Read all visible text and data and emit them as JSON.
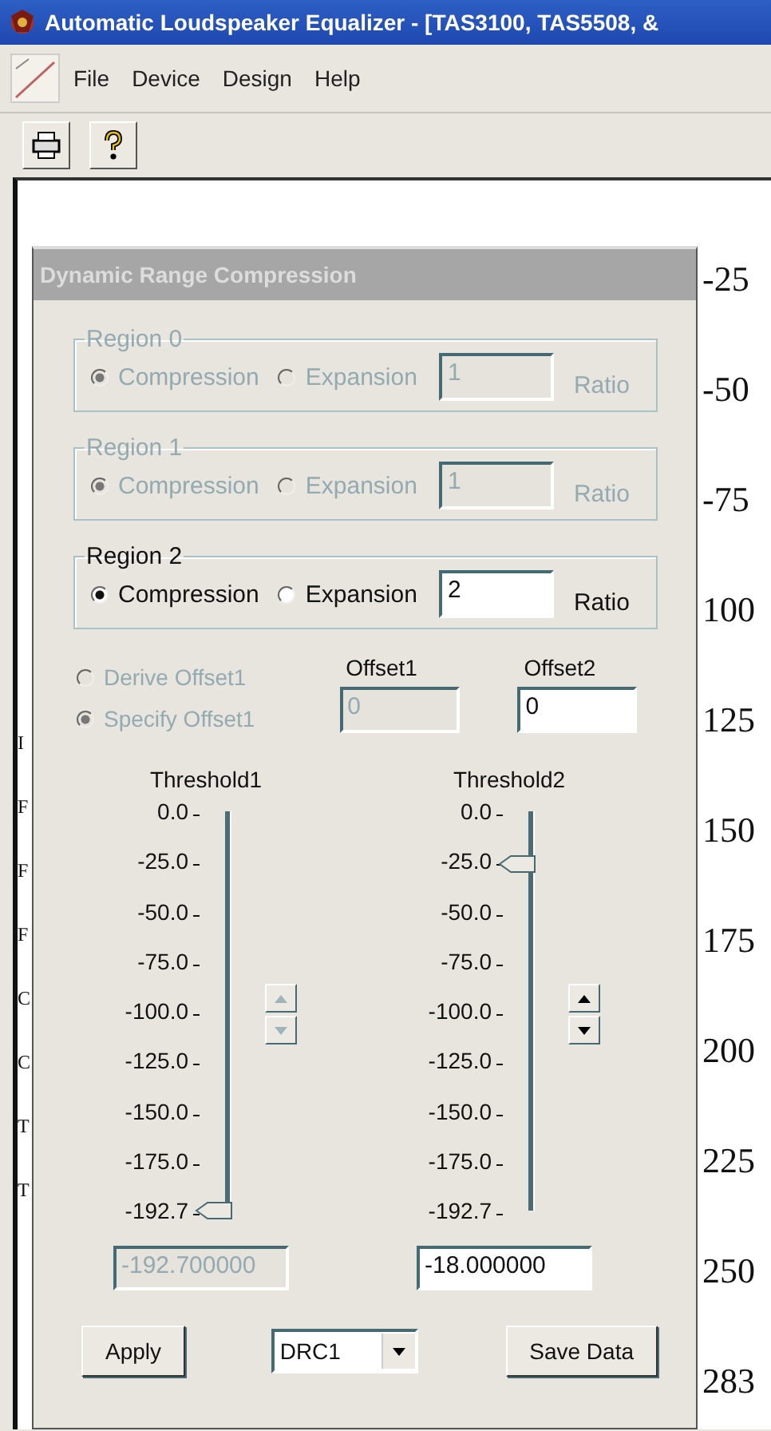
{
  "window": {
    "title": "Automatic Loudspeaker Equalizer - [TAS3100, TAS5508, &"
  },
  "menu": [
    {
      "label": "File"
    },
    {
      "label": "Device"
    },
    {
      "label": "Design"
    },
    {
      "label": "Help"
    }
  ],
  "toolbar": [
    {
      "kind": "print"
    },
    {
      "kind": "help"
    }
  ],
  "background_chart": {
    "left_fragments": [
      "I",
      "F",
      "F",
      "F",
      "C",
      "C",
      "T",
      "T"
    ],
    "axis_labels": [
      "-25",
      "-50",
      "-75",
      "100",
      "125",
      "150",
      "175",
      "200",
      "225",
      "250",
      "283"
    ]
  },
  "dialog": {
    "title": "Dynamic Range Compression",
    "regions": [
      {
        "label": "Region 0",
        "disabled": true,
        "options": [
          {
            "label": "Compression",
            "selected": true
          },
          {
            "label": "Expansion",
            "selected": false
          }
        ],
        "ratio": "1",
        "ratio_label": "Ratio"
      },
      {
        "label": "Region 1",
        "disabled": true,
        "options": [
          {
            "label": "Compression",
            "selected": true
          },
          {
            "label": "Expansion",
            "selected": false
          }
        ],
        "ratio": "1",
        "ratio_label": "Ratio"
      },
      {
        "label": "Region 2",
        "disabled": false,
        "options": [
          {
            "label": "Compression",
            "selected": true
          },
          {
            "label": "Expansion",
            "selected": false
          }
        ],
        "ratio": "2",
        "ratio_label": "Ratio"
      }
    ],
    "offset_modes": [
      {
        "label": "Derive Offset1",
        "selected": false,
        "disabled": true
      },
      {
        "label": "Specify Offset1",
        "selected": true,
        "disabled": true
      }
    ],
    "offsets": [
      {
        "label": "Offset1",
        "value": "0",
        "disabled": true
      },
      {
        "label": "Offset2",
        "value": "0",
        "disabled": false
      }
    ],
    "thresholds": [
      {
        "label": "Threshold1",
        "ticks": [
          "0.0",
          "-25.0",
          "-50.0",
          "-75.0",
          "-100.0",
          "-125.0",
          "-150.0",
          "-175.0",
          "-192.7"
        ],
        "level": 0,
        "value": "-192.700000",
        "disabled": true
      },
      {
        "label": "Threshold2",
        "ticks": [
          "0.0",
          "-25.0",
          "-50.0",
          "-75.0",
          "-100.0",
          "-125.0",
          "-150.0",
          "-175.0",
          "-192.7"
        ],
        "level": 0.87,
        "value": "-18.000000",
        "disabled": false
      }
    ],
    "footer": [
      {
        "kind": "button",
        "label": "Apply"
      },
      {
        "kind": "select",
        "value": "DRC1"
      },
      {
        "kind": "button",
        "label": "Save Data"
      }
    ]
  }
}
